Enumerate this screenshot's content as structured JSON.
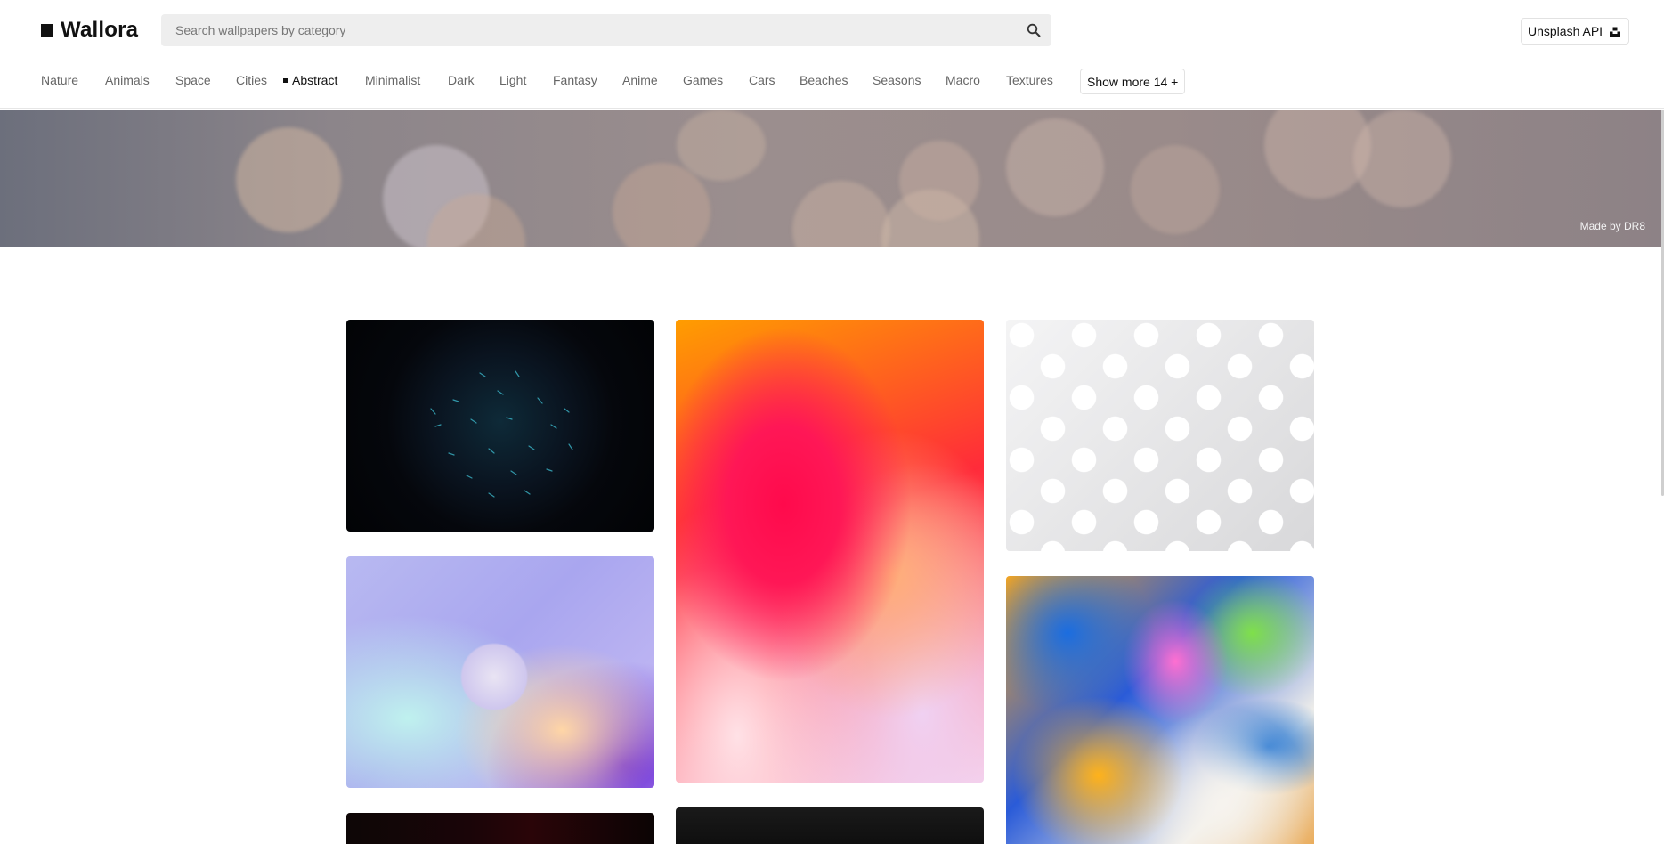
{
  "app": {
    "name": "Wallora"
  },
  "search": {
    "placeholder": "Search wallpapers by category"
  },
  "api_button": {
    "label": "Unsplash API"
  },
  "nav": {
    "items": [
      {
        "label": "Nature"
      },
      {
        "label": "Animals"
      },
      {
        "label": "Space"
      },
      {
        "label": "Cities"
      },
      {
        "label": "Abstract",
        "active": true
      },
      {
        "label": "Minimalist"
      },
      {
        "label": "Dark"
      },
      {
        "label": "Light"
      },
      {
        "label": "Fantasy"
      },
      {
        "label": "Anime"
      },
      {
        "label": "Games"
      },
      {
        "label": "Cars"
      },
      {
        "label": "Beaches"
      },
      {
        "label": "Seasons"
      },
      {
        "label": "Macro"
      },
      {
        "label": "Textures"
      }
    ],
    "show_more": "Show more 14 +"
  },
  "banner": {
    "credit": "Made by  DR8"
  },
  "colors": {
    "text": "#111111",
    "muted": "#666666",
    "search_bg": "#eeeeee"
  },
  "icons": {
    "search": "search-icon",
    "unsplash": "unsplash-icon",
    "logo": "logo-square-icon"
  }
}
